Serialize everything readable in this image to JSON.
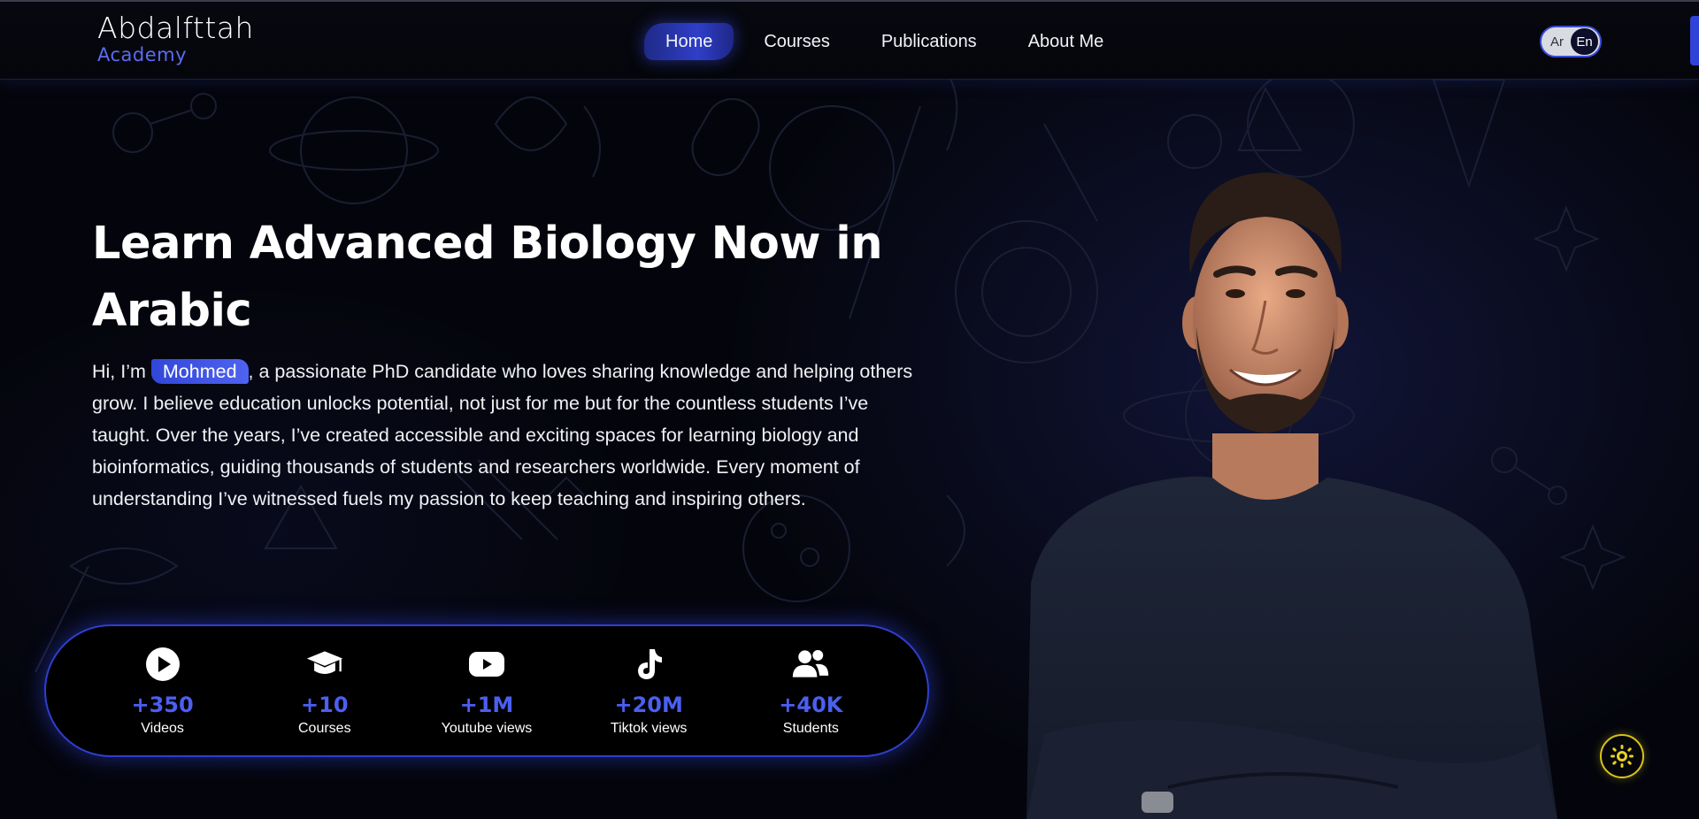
{
  "brand": {
    "name": "Abdalfttah",
    "tagline": "Academy"
  },
  "nav": {
    "items": [
      {
        "label": "Home",
        "active": true
      },
      {
        "label": "Courses",
        "active": false
      },
      {
        "label": "Publications",
        "active": false
      },
      {
        "label": "About Me",
        "active": false
      }
    ]
  },
  "language": {
    "options": [
      "Ar",
      "En"
    ],
    "selected": "En"
  },
  "hero": {
    "title": "Learn Advanced Biology Now in Arabic",
    "intro_prefix": "Hi, I’m ",
    "name": "Mohmed",
    "intro_body": ", a passionate PhD candidate who loves sharing knowledge and helping others grow. I believe education unlocks potential, not just for me but for the countless students I’ve taught. Over the years, I’ve created accessible and exciting spaces for learning biology and bioinformatics, guiding thousands of students and researchers worldwide. Every moment of understanding I’ve witnessed fuels my passion to keep teaching and inspiring others."
  },
  "stats": [
    {
      "icon": "play-circle-icon",
      "value": "+350",
      "label": "Videos"
    },
    {
      "icon": "graduation-cap-icon",
      "value": "+10",
      "label": "Courses"
    },
    {
      "icon": "youtube-icon",
      "value": "+1M",
      "label": "Youtube views"
    },
    {
      "icon": "tiktok-icon",
      "value": "+20M",
      "label": "Tiktok views"
    },
    {
      "icon": "users-icon",
      "value": "+40K",
      "label": "Students"
    }
  ],
  "colors": {
    "accent": "#4b5ff0",
    "background": "#04050c",
    "theme_button": "#d9c21a"
  }
}
